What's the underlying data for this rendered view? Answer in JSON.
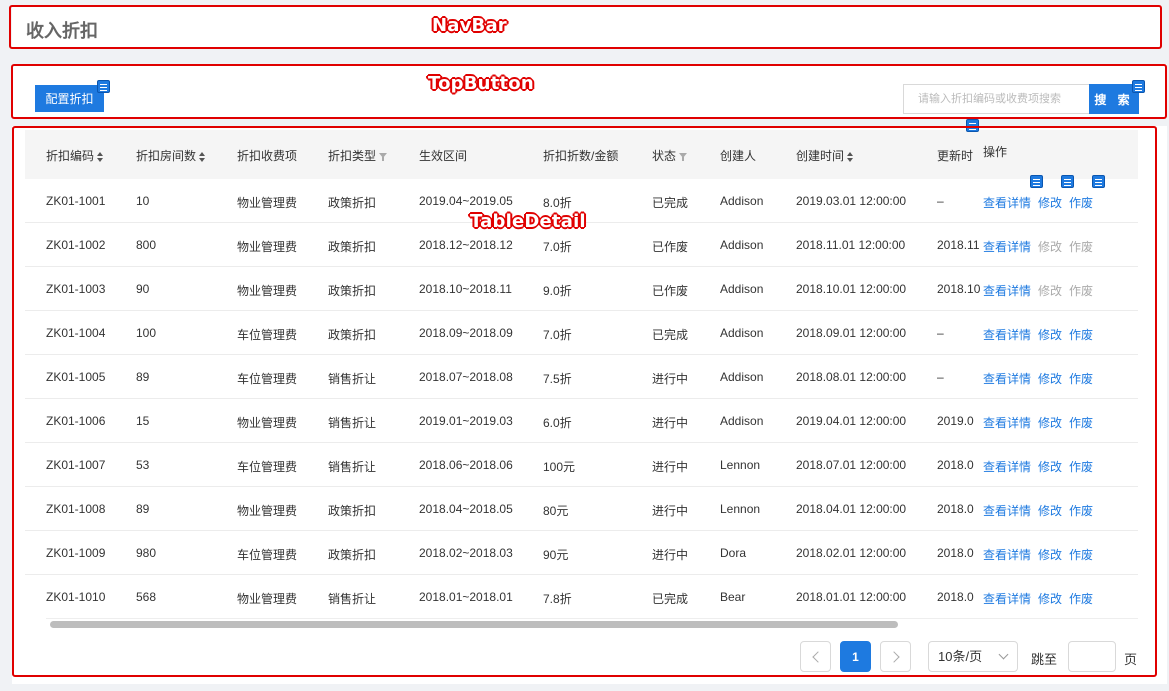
{
  "annotations": {
    "navbar": "NavBar",
    "topbutton": "TopButton",
    "tabledetail": "TableDetail"
  },
  "navbar": {
    "title": "收入折扣"
  },
  "topbar": {
    "config_button": "配置折扣",
    "search_placeholder": "请输入折扣编码或收费项搜索",
    "search_button": "搜 索"
  },
  "table": {
    "columns": {
      "code": "折扣编码",
      "rooms": "折扣房间数",
      "fee_item": "折扣收费项",
      "type": "折扣类型",
      "period": "生效区间",
      "discount": "折扣折数/金额",
      "status": "状态",
      "creator": "创建人",
      "created": "创建时间",
      "updated": "更新时",
      "ops": "操作"
    },
    "rows": [
      {
        "code": "ZK01-1001",
        "rooms": "10",
        "fee_item": "物业管理费",
        "type": "政策折扣",
        "period": "2019.04~2019.05",
        "discount": "8.0折",
        "status": "已完成",
        "creator": "Addison",
        "created": "2019.03.01 12:00:00",
        "updated": "–",
        "view": "查看详情",
        "edit": "修改",
        "void": "作废",
        "edit_disabled": false,
        "void_disabled": false
      },
      {
        "code": "ZK01-1002",
        "rooms": "800",
        "fee_item": "物业管理费",
        "type": "政策折扣",
        "period": "2018.12~2018.12",
        "discount": "7.0折",
        "status": "已作废",
        "creator": "Addison",
        "created": "2018.11.01 12:00:00",
        "updated": "2018.11",
        "view": "查看详情",
        "edit": "修改",
        "void": "作废",
        "edit_disabled": true,
        "void_disabled": true
      },
      {
        "code": "ZK01-1003",
        "rooms": "90",
        "fee_item": "物业管理费",
        "type": "政策折扣",
        "period": "2018.10~2018.11",
        "discount": "9.0折",
        "status": "已作废",
        "creator": "Addison",
        "created": "2018.10.01 12:00:00",
        "updated": "2018.10",
        "view": "查看详情",
        "edit": "修改",
        "void": "作废",
        "edit_disabled": true,
        "void_disabled": true
      },
      {
        "code": "ZK01-1004",
        "rooms": "100",
        "fee_item": "车位管理费",
        "type": "政策折扣",
        "period": "2018.09~2018.09",
        "discount": "7.0折",
        "status": "已完成",
        "creator": "Addison",
        "created": "2018.09.01 12:00:00",
        "updated": "–",
        "view": "查看详情",
        "edit": "修改",
        "void": "作废",
        "edit_disabled": false,
        "void_disabled": false
      },
      {
        "code": "ZK01-1005",
        "rooms": "89",
        "fee_item": "车位管理费",
        "type": "销售折让",
        "period": "2018.07~2018.08",
        "discount": "7.5折",
        "status": "进行中",
        "creator": "Addison",
        "created": "2018.08.01 12:00:00",
        "updated": "–",
        "view": "查看详情",
        "edit": "修改",
        "void": "作废",
        "edit_disabled": false,
        "void_disabled": false
      },
      {
        "code": "ZK01-1006",
        "rooms": "15",
        "fee_item": "物业管理费",
        "type": "销售折让",
        "period": "2019.01~2019.03",
        "discount": "6.0折",
        "status": "进行中",
        "creator": "Addison",
        "created": "2019.04.01 12:00:00",
        "updated": "2019.0",
        "view": "查看详情",
        "edit": "修改",
        "void": "作废",
        "edit_disabled": false,
        "void_disabled": false
      },
      {
        "code": "ZK01-1007",
        "rooms": "53",
        "fee_item": "车位管理费",
        "type": "销售折让",
        "period": "2018.06~2018.06",
        "discount": "100元",
        "status": "进行中",
        "creator": "Lennon",
        "created": "2018.07.01 12:00:00",
        "updated": "2018.0",
        "view": "查看详情",
        "edit": "修改",
        "void": "作废",
        "edit_disabled": false,
        "void_disabled": false
      },
      {
        "code": "ZK01-1008",
        "rooms": "89",
        "fee_item": "物业管理费",
        "type": "政策折扣",
        "period": "2018.04~2018.05",
        "discount": "80元",
        "status": "进行中",
        "creator": "Lennon",
        "created": "2018.04.01 12:00:00",
        "updated": "2018.0",
        "view": "查看详情",
        "edit": "修改",
        "void": "作废",
        "edit_disabled": false,
        "void_disabled": false
      },
      {
        "code": "ZK01-1009",
        "rooms": "980",
        "fee_item": "车位管理费",
        "type": "政策折扣",
        "period": "2018.02~2018.03",
        "discount": "90元",
        "status": "进行中",
        "creator": "Dora",
        "created": "2018.02.01 12:00:00",
        "updated": "2018.0",
        "view": "查看详情",
        "edit": "修改",
        "void": "作废",
        "edit_disabled": false,
        "void_disabled": false
      },
      {
        "code": "ZK01-1010",
        "rooms": "568",
        "fee_item": "物业管理费",
        "type": "销售折让",
        "period": "2018.01~2018.01",
        "discount": "7.8折",
        "status": "已完成",
        "creator": "Bear",
        "created": "2018.01.01 12:00:00",
        "updated": "2018.0",
        "view": "查看详情",
        "edit": "修改",
        "void": "作废",
        "edit_disabled": false,
        "void_disabled": false
      }
    ]
  },
  "pagination": {
    "current_page": "1",
    "page_size": "10条/页",
    "jump_label": "跳至",
    "page_suffix": "页"
  },
  "colors": {
    "primary": "#1e7ae0",
    "annotation_red": "#e00000",
    "disabled_link": "#aaaaaa"
  },
  "icons": [
    "doc-list-icon",
    "sort-icon",
    "filter-icon",
    "chevron-left-icon",
    "chevron-right-icon",
    "chevron-down-icon"
  ]
}
